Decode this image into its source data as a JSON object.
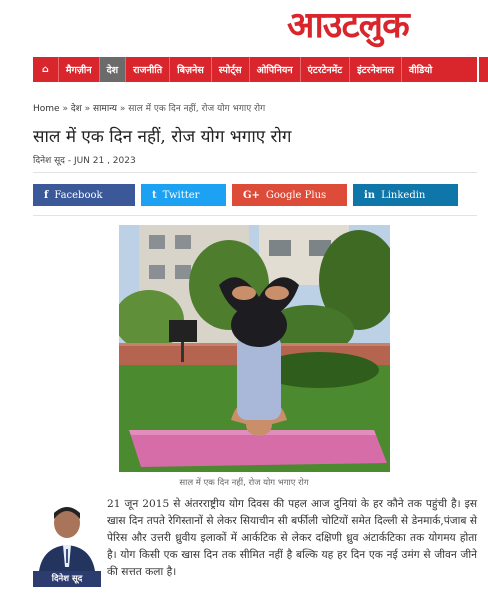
{
  "site": {
    "logo": "आउटलुक",
    "accent": "#d8262c"
  },
  "nav": {
    "items": [
      {
        "label": "⌂",
        "icon": "home-icon"
      },
      {
        "label": "मैगज़ीन"
      },
      {
        "label": "देश",
        "active": true
      },
      {
        "label": "राजनीति"
      },
      {
        "label": "बिज़नेस"
      },
      {
        "label": "स्पोर्ट्स"
      },
      {
        "label": "ओपिनियन"
      },
      {
        "label": "एंटरटेनमेंट"
      },
      {
        "label": "इंटरनेशनल"
      },
      {
        "label": "वीडियो"
      }
    ]
  },
  "breadcrumb": {
    "home": "Home",
    "sep": "»",
    "l1": "देश",
    "l2": "सामान्य",
    "current": "साल में एक दिन नहीं, रोज योग भगाए रोग"
  },
  "article": {
    "title": "साल में एक दिन नहीं, रोज योग भगाए रोग",
    "author": "दिनेश सूद",
    "date": "JUN 21 , 2023",
    "byline_sep": " - ",
    "caption": "साल में एक दिन नहीं, रोज योग भगाए रोग",
    "body": "21 जून 2015 से अंतरराष्ट्रीय योग दिवस की पहल आज दुनियां के हर कौने तक पहुंची है। इस खास दिन तपते रेगिस्तानों से लेकर सियाचीन सी बर्फीली चोटियों समेत दिल्ली से डेनमार्क,पंजाब से पेरिस और उत्तरी ध्रुवीय इलाकों में आर्कटिक से लेकर दक्षिणी ध्रुव अंटार्कटिका तक योगमय होता है। योग किसी एक खास दिन तक सीमित नहीं है बल्कि यह हर दिन एक नई उमंग से जीवन जीने की सत्तत कला है।",
    "author_box_name": "दिनेश सूद"
  },
  "share": {
    "facebook": {
      "icon": "f",
      "label": "Facebook"
    },
    "twitter": {
      "icon": "t",
      "label": "Twitter"
    },
    "googleplus": {
      "icon": "G+",
      "label": "Google Plus"
    },
    "linkedin": {
      "icon": "in",
      "label": "Linkedin"
    }
  }
}
